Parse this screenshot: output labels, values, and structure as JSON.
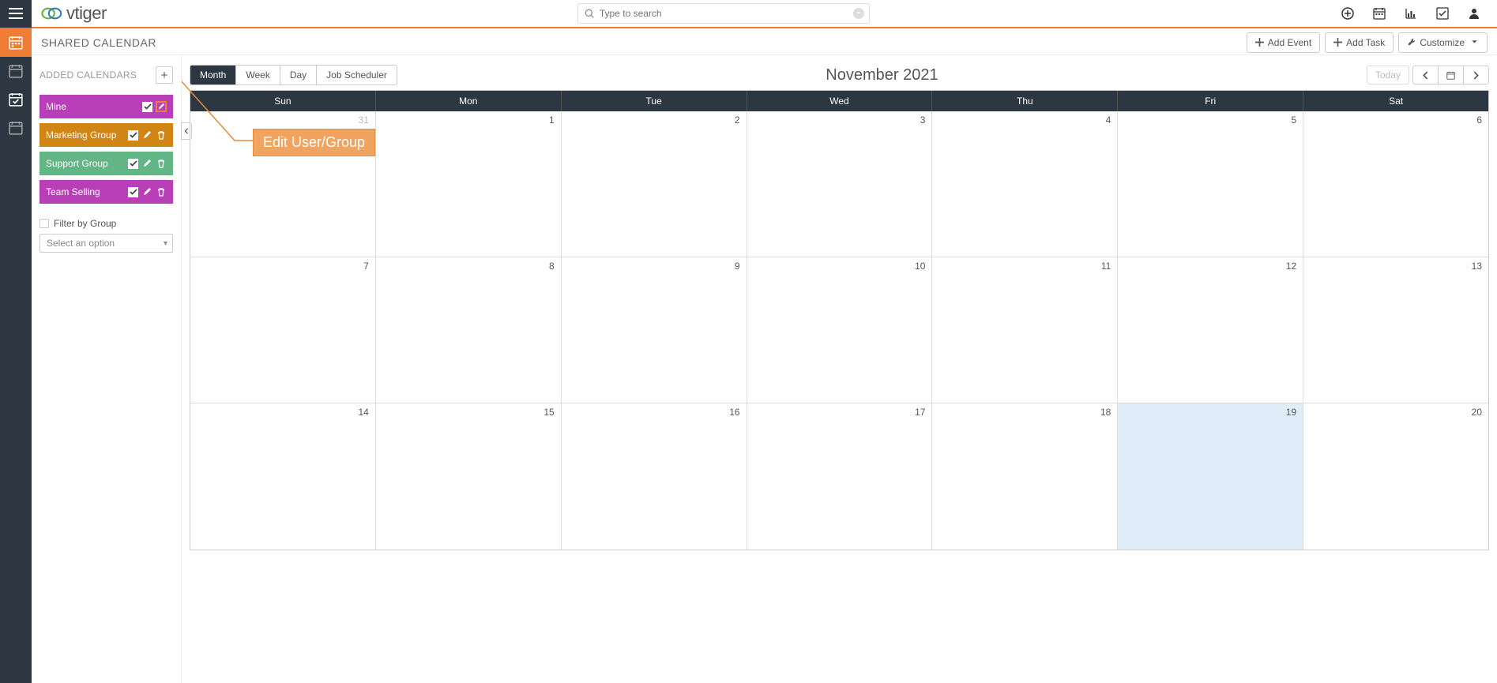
{
  "app": {
    "name": "vtiger"
  },
  "search": {
    "placeholder": "Type to search"
  },
  "page_title": "SHARED CALENDAR",
  "actions": {
    "add_event": "Add Event",
    "add_task": "Add Task",
    "customize": "Customize"
  },
  "sidebar": {
    "header": "ADDED CALENDARS",
    "items": [
      {
        "label": "Mine",
        "type": "mine"
      },
      {
        "label": "Marketing Group",
        "type": "group"
      },
      {
        "label": "Support Group",
        "type": "group"
      },
      {
        "label": "Team Selling",
        "type": "group"
      }
    ],
    "filter_label": "Filter by Group",
    "select_placeholder": "Select an option"
  },
  "annotation": {
    "text": "Edit User/Group"
  },
  "calendar": {
    "views": [
      "Month",
      "Week",
      "Day",
      "Job Scheduler"
    ],
    "active_view": "Month",
    "title": "November 2021",
    "today_label": "Today",
    "day_headers": [
      "Sun",
      "Mon",
      "Tue",
      "Wed",
      "Thu",
      "Fri",
      "Sat"
    ],
    "weeks": [
      [
        {
          "n": "31",
          "other": true
        },
        {
          "n": "1"
        },
        {
          "n": "2"
        },
        {
          "n": "3"
        },
        {
          "n": "4"
        },
        {
          "n": "5"
        },
        {
          "n": "6"
        }
      ],
      [
        {
          "n": "7"
        },
        {
          "n": "8"
        },
        {
          "n": "9"
        },
        {
          "n": "10"
        },
        {
          "n": "11"
        },
        {
          "n": "12"
        },
        {
          "n": "13"
        }
      ],
      [
        {
          "n": "14"
        },
        {
          "n": "15"
        },
        {
          "n": "16"
        },
        {
          "n": "17"
        },
        {
          "n": "18"
        },
        {
          "n": "19",
          "today": true
        },
        {
          "n": "20"
        }
      ]
    ]
  }
}
